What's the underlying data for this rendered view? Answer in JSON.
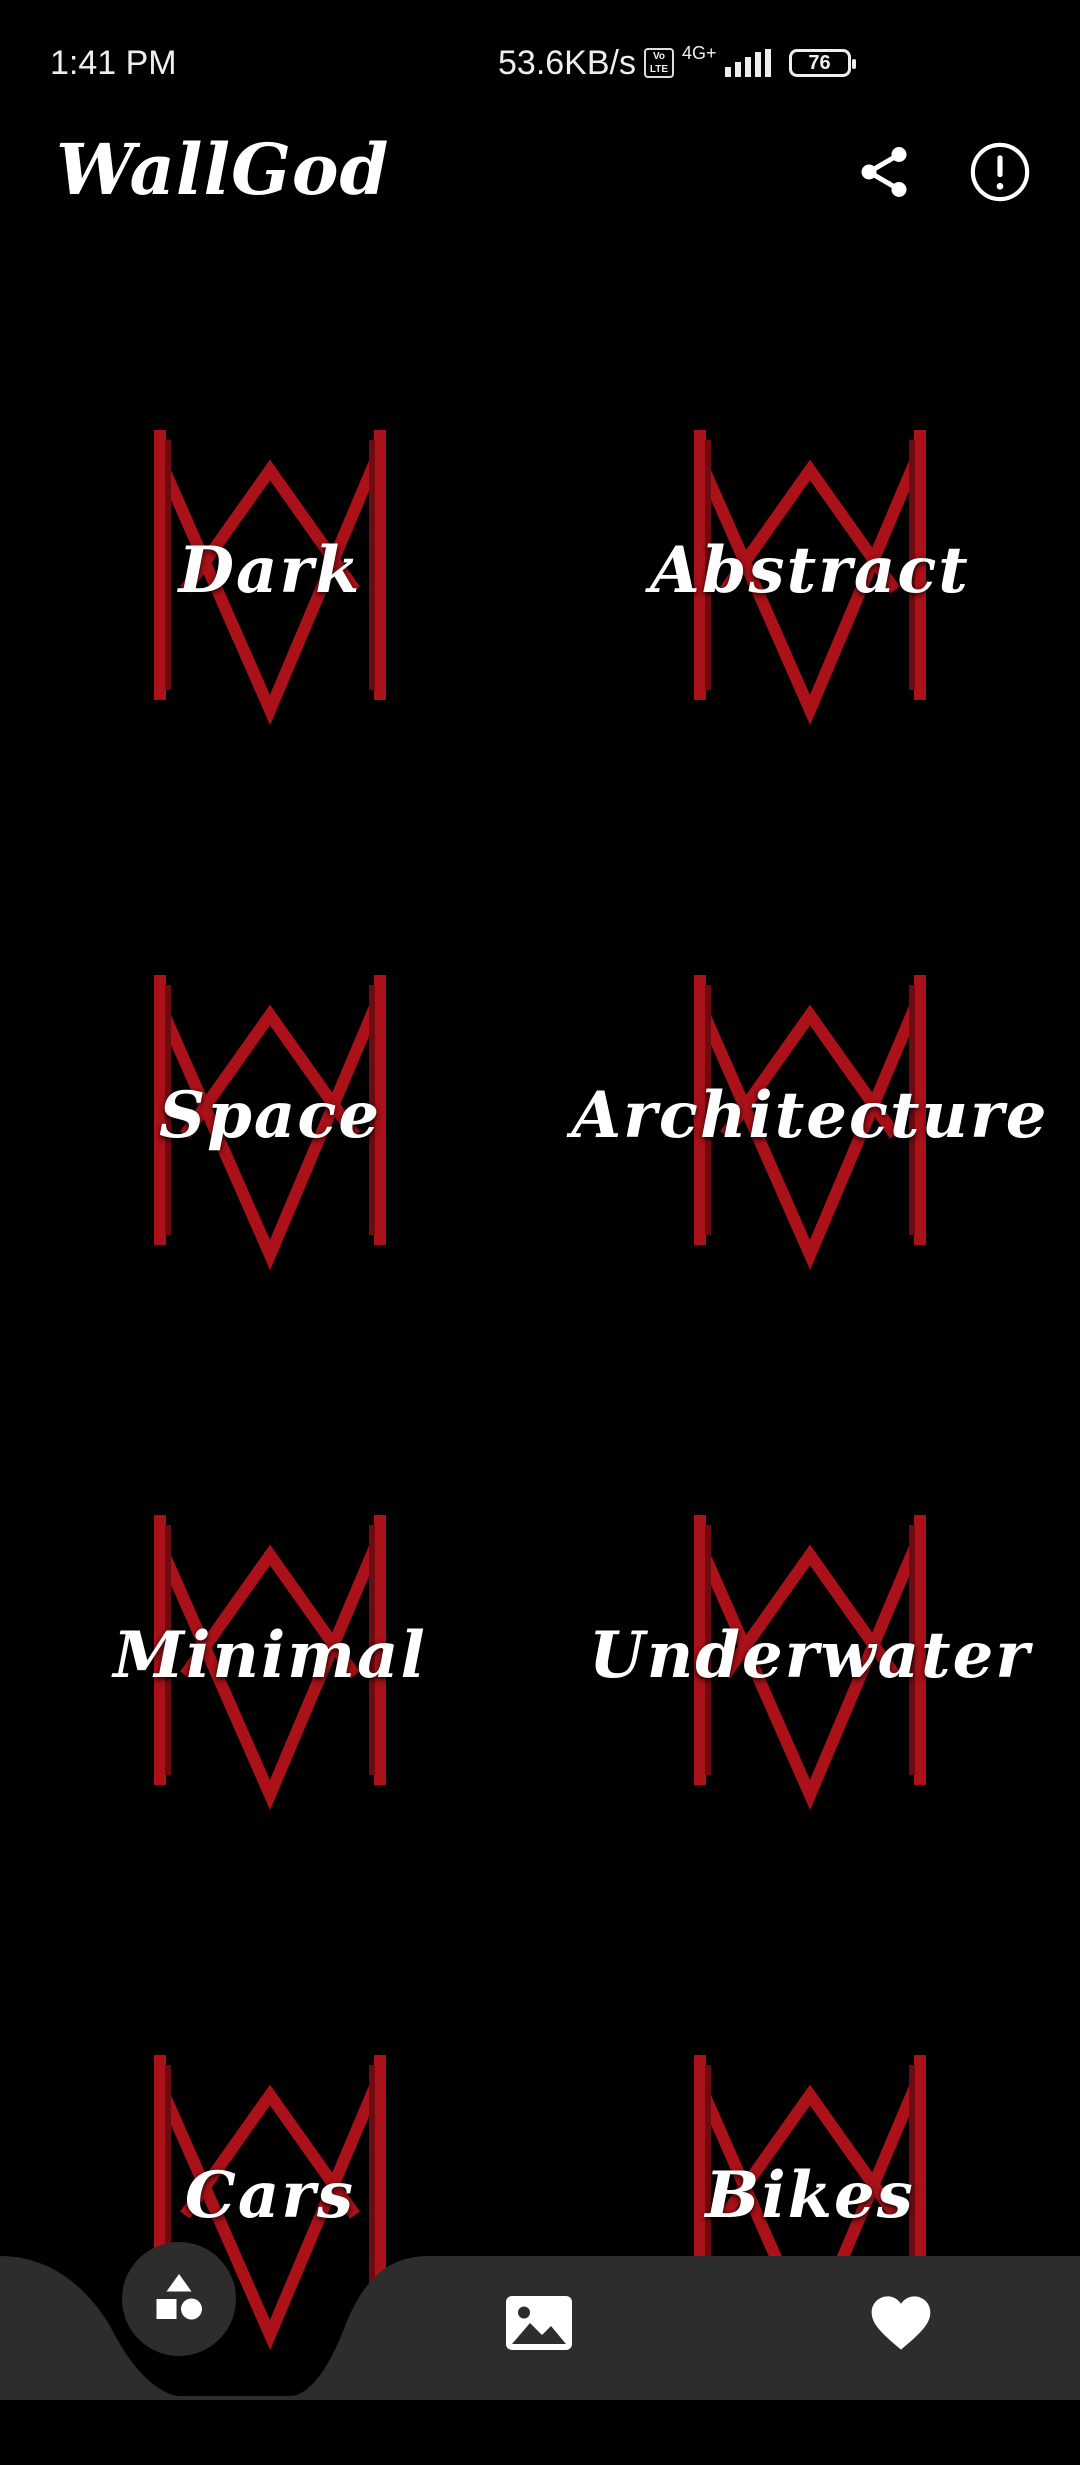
{
  "status_bar": {
    "time": "1:41 PM",
    "net_speed": "53.6KB/s",
    "volte": "Vo LTE",
    "network": "4G+",
    "battery": "76"
  },
  "app": {
    "title": "WallGod"
  },
  "icons": {
    "share": "share-icon",
    "info": "info-icon",
    "categories": "categories-icon",
    "gallery": "image-icon",
    "favorites": "heart-icon"
  },
  "categories": [
    {
      "label": "Dark"
    },
    {
      "label": "Abstract"
    },
    {
      "label": "Space"
    },
    {
      "label": "Architecture"
    },
    {
      "label": "Minimal"
    },
    {
      "label": "Underwater"
    },
    {
      "label": "Cars"
    },
    {
      "label": "Bikes"
    }
  ],
  "colors": {
    "background": "#000000",
    "logo_red": "#c8141c",
    "nav_bar": "#2d2d2d",
    "text": "#ffffff"
  }
}
